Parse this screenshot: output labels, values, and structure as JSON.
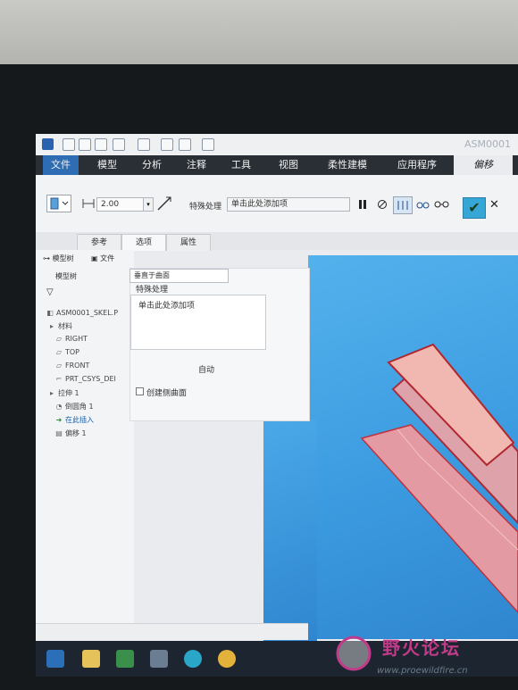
{
  "window": {
    "title": "ASM0001"
  },
  "menu": {
    "tabs": [
      "文件",
      "模型",
      "分析",
      "注释",
      "工具",
      "视图",
      "柔性建模",
      "应用程序",
      "偏移"
    ]
  },
  "ribbon": {
    "offset_value": "2.00",
    "special_label": "特殊处理",
    "special_collector": "单击此处添加项"
  },
  "dashboard": {
    "tabs": [
      "参考",
      "选项",
      "属性"
    ]
  },
  "tree": {
    "tab_model": "模型树",
    "tab_file": "文件",
    "header": "模型树",
    "items": [
      "ASM0001_SKEL.P",
      "材料",
      "RIGHT",
      "TOP",
      "FRONT",
      "PRT_CSYS_DEI",
      "拉伸 1",
      "倒圆角 1",
      "在此插入",
      "偏移 1"
    ]
  },
  "options": {
    "mode": "垂直于曲面",
    "special_label": "特殊处理",
    "collector": "单击此处添加项",
    "auto_button": "自动",
    "create_side": "创建侧曲面"
  },
  "watermark": {
    "title": "野火论坛",
    "url": "www.proewildfire.cn"
  },
  "colors": {
    "accent": "#2e6db4",
    "viewport": "#3c9be0",
    "part": "#e7a3a8",
    "part_edge": "#b2262e",
    "ok": "#36a6d6"
  }
}
